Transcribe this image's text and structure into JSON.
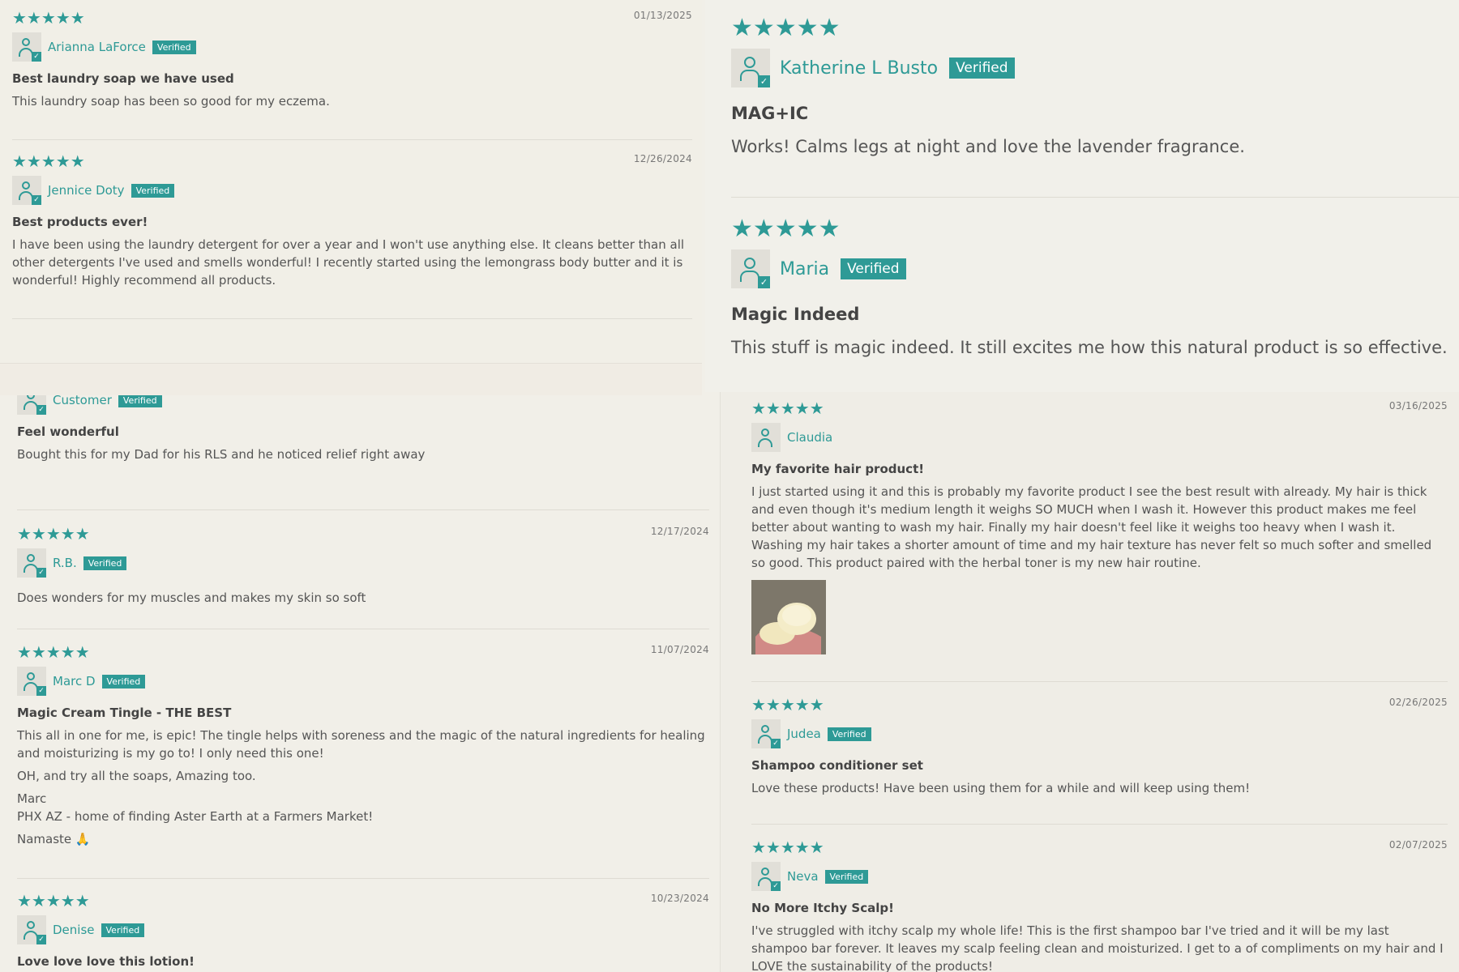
{
  "star_glyph": "★★★★★",
  "colors": {
    "accent": "#2e9a96",
    "background": "#f1efe8",
    "text": "#555555"
  },
  "panel_a": {
    "reviews": [
      {
        "date": "01/13/2025",
        "name": "Arianna LaForce",
        "badge": "Verified",
        "title": "Best laundry soap we have used",
        "body": [
          "This laundry soap has been so good for my eczema."
        ]
      },
      {
        "date": "12/26/2024",
        "name": "Jennice Doty",
        "badge": "Verified",
        "title": "Best products ever!",
        "body": [
          "I have been using the laundry detergent for over a year and I won't use anything else. It cleans better than all other detergents I've used and smells wonderful! I recently started using the lemongrass body butter and it is wonderful! Highly recommend all products."
        ]
      }
    ]
  },
  "panel_b": {
    "reviews": [
      {
        "name": "Katherine L Busto",
        "badge": "Verified",
        "title": "MAG+IC",
        "body": [
          "Works! Calms legs at night and love the lavender fragrance."
        ]
      },
      {
        "name": "Maria",
        "badge": "Verified",
        "title": "Magic Indeed",
        "body": [
          "This stuff is magic indeed. It still excites me how this natural product is so effective."
        ]
      }
    ]
  },
  "panel_c": {
    "partial": {
      "name": "Customer",
      "badge": "Verified",
      "title": "Feel wonderful",
      "body": [
        "Bought this for my Dad for his RLS and he noticed relief right away"
      ]
    },
    "reviews": [
      {
        "date": "12/17/2024",
        "name": "R.B.",
        "badge": "Verified",
        "title": "",
        "body": [
          "Does wonders for my muscles and makes my skin so soft"
        ]
      },
      {
        "date": "11/07/2024",
        "name": "Marc D",
        "badge": "Verified",
        "title": "Magic Cream Tingle - THE BEST",
        "body": [
          "This all in one for me, is epic! The tingle helps with soreness and the magic of the natural ingredients for healing and moisturizing is my go to! I only need this one!",
          "OH, and try all the soaps, Amazing too.",
          "Marc\nPHX AZ - home of finding Aster Earth at a Farmers Market!",
          "Namaste 🙏"
        ]
      },
      {
        "date": "10/23/2024",
        "name": "Denise",
        "badge": "Verified",
        "title": "Love love love this lotion!",
        "body": []
      }
    ]
  },
  "panel_d": {
    "reviews": [
      {
        "date": "03/16/2025",
        "name": "Claudia",
        "badge": "",
        "title": "My favorite hair product!",
        "body": [
          "I just started using it and this is probably my favorite product I see the best result with already. My hair is thick and even though it's medium length it weighs SO MUCH when I wash it. However this product makes me feel better about wanting to wash my hair. Finally my hair doesn't feel like it weighs too heavy when I wash it. Washing my hair takes a shorter amount of time and my hair texture has never felt so much softer and smelled so good. This product paired with the herbal toner is my new hair routine."
        ],
        "has_photo": true
      },
      {
        "date": "02/26/2025",
        "name": "Judea",
        "badge": "Verified",
        "title": "Shampoo conditioner set",
        "body": [
          "Love these products! Have been using them for a while and will keep using them!"
        ]
      },
      {
        "date": "02/07/2025",
        "name": "Neva",
        "badge": "Verified",
        "title": "No More Itchy Scalp!",
        "body": [
          "I've struggled with itchy scalp my whole life! This is the first shampoo bar I've tried and it will be my last shampoo bar forever. It leaves my scalp feeling clean and moisturized. I get to a of compliments on my hair and I LOVE the sustainability of the products!"
        ]
      }
    ]
  }
}
